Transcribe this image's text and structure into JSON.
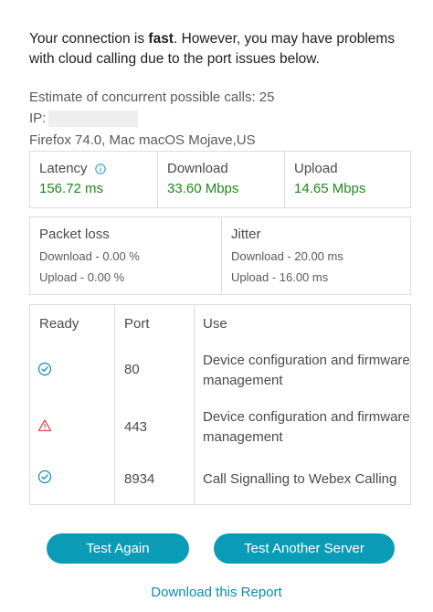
{
  "summary": {
    "prefix": "Your connection is ",
    "speed_word": "fast",
    "suffix": ". However, you may have problems with cloud calling due to the port issues below."
  },
  "estimate": {
    "label": "Estimate of concurrent possible calls:",
    "value": "25"
  },
  "ip_label": "IP:",
  "browser_info": "Firefox 74.0, Mac macOS Mojave,US",
  "metrics": {
    "latency": {
      "label": "Latency",
      "value": "156.72 ms",
      "icon": "info-icon"
    },
    "download": {
      "label": "Download",
      "value": "33.60 Mbps"
    },
    "upload": {
      "label": "Upload",
      "value": "14.65 Mbps"
    }
  },
  "packet_loss": {
    "label": "Packet loss",
    "download": "Download - 0.00 %",
    "upload": "Upload - 0.00 %"
  },
  "jitter": {
    "label": "Jitter",
    "download": "Download - 20.00 ms",
    "upload": "Upload - 16.00 ms"
  },
  "ports_table": {
    "headers": {
      "ready": "Ready",
      "port": "Port",
      "use": "Use"
    },
    "rows": [
      {
        "status": "ok",
        "icon": "check-circle-icon",
        "port": "80",
        "use": "Device configuration and firmware management"
      },
      {
        "status": "warning",
        "icon": "warning-triangle-icon",
        "port": "443",
        "use": "Device configuration and firmware management"
      },
      {
        "status": "ok",
        "icon": "check-circle-icon",
        "port": "8934",
        "use": "Call Signalling to Webex Calling"
      }
    ]
  },
  "buttons": {
    "test_again": "Test Again",
    "test_another_server": "Test Another Server"
  },
  "download_link": "Download this Report",
  "colors": {
    "accent": "#0a9bb6",
    "good": "#1c8a1c",
    "warning": "#d9534f",
    "ok_icon": "#1a8fbf"
  }
}
